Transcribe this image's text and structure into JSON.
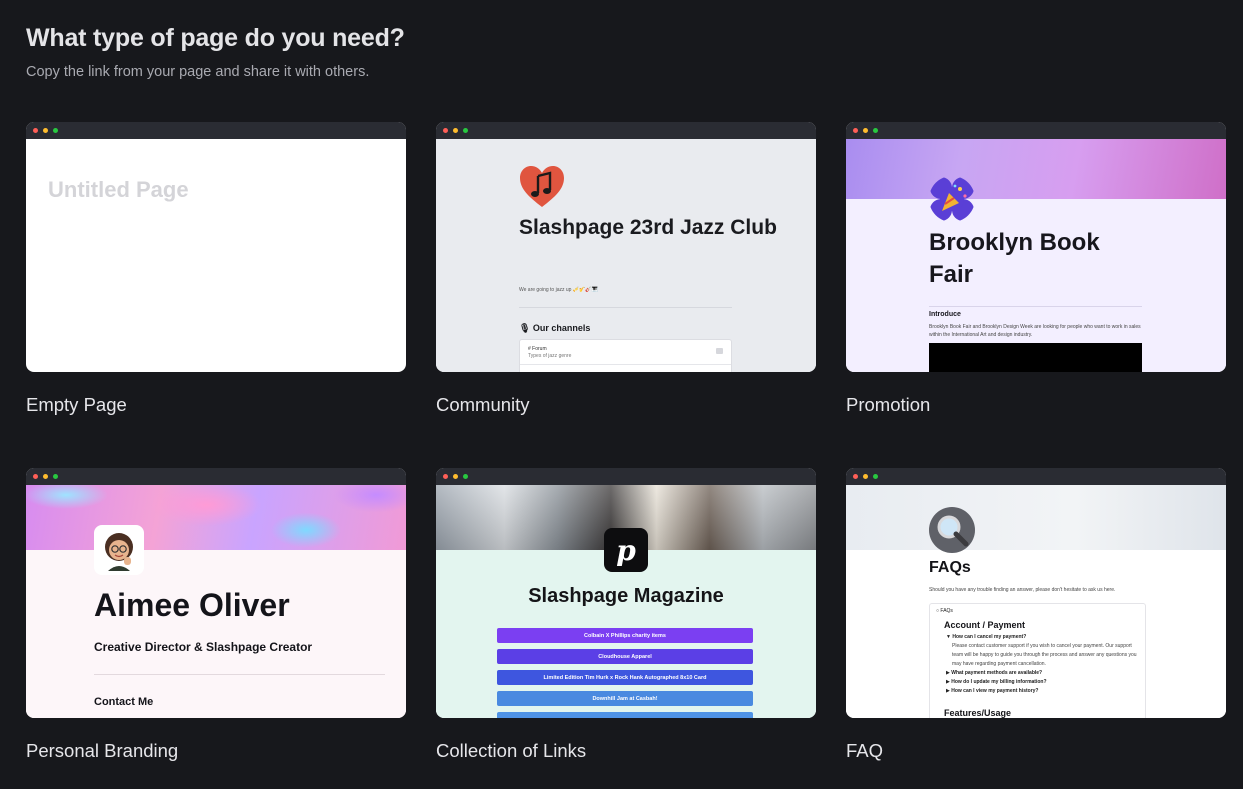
{
  "header": {
    "title": "What type of page do you need?",
    "subtitle": "Copy the link from your page and share it with others."
  },
  "templates": {
    "empty": {
      "label": "Empty Page",
      "preview_title": "Untitled Page"
    },
    "community": {
      "label": "Community",
      "title": "Slashpage 23rd Jazz Club",
      "description": "We are going to jazz up 🎺🎷🎸🎹",
      "channels_heading": "🎙 Our channels",
      "channel_name": "# Forum",
      "channel_desc": "Types of jazz genre"
    },
    "promotion": {
      "label": "Promotion",
      "title": "Brooklyn Book Fair",
      "intro_heading": "Introduce",
      "intro_text": "Brooklyn Book Fair and Brooklyn Design Week are looking for people who want to work in sales within the International Art and design industry."
    },
    "branding": {
      "label": "Personal Branding",
      "name": "Aimee Oliver",
      "role": "Creative Director & Slashpage Creator",
      "contact": "Contact Me"
    },
    "links": {
      "label": "Collection of Links",
      "logo": "p",
      "title": "Slashpage Magazine",
      "buttons": [
        "Colbain X Phillips charity items",
        "Cloudhouse Apparel",
        "Limited Edition Tim Hurk x Rock Hank Autographed 8x10 Card",
        "Downhill Jam at Casbah!",
        ""
      ],
      "button_colors": [
        "#7b3ff2",
        "#5b3fe6",
        "#3e56df",
        "#4a8ae0",
        "#4f93e6"
      ]
    },
    "faq": {
      "label": "FAQ",
      "title": "FAQs",
      "description": "Should you have any trouble finding an answer, please don't hesitate to ask us here.",
      "box_label": "FAQs",
      "category1": "Account / Payment",
      "q1": "How can I cancel my payment?",
      "a1": "Please contact customer support if you wish to cancel your payment. Our support team will be happy to guide you through the process and answer any questions you may have regarding payment cancellation.",
      "q2": "What payment methods are available?",
      "q3": "How do I update my billing information?",
      "q4": "How can I view my payment history?",
      "category2": "Features/Usage"
    }
  },
  "colors": {
    "background": "#17181c",
    "titlebar": "#2a2c33"
  }
}
